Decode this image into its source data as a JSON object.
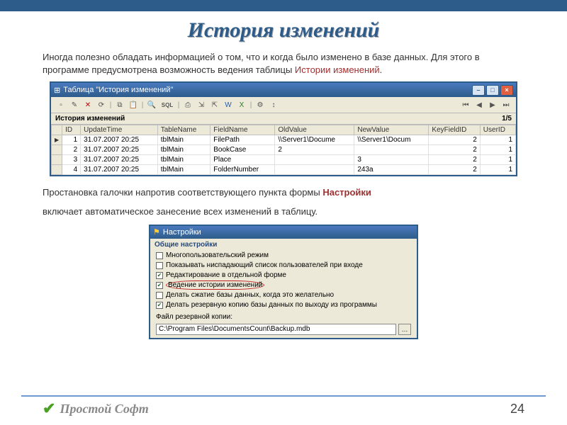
{
  "slide": {
    "title": "История изменений",
    "intro_plain": "Иногда полезно обладать информацией о том, что и когда было изменено в базе данных. Для этого в программе предусмотрена возможность ведения таблицы ",
    "intro_hl": "Истории изменений",
    "para2_a": "Простановка галочки напротив соответствующего пункта формы ",
    "para2_hl": "Настройки",
    "para2_b": "включает автоматическое занесение всех изменений в таблицу."
  },
  "history_window": {
    "title": "Таблица \"История изменений\"",
    "subheader": "История изменений",
    "counter": "1/5",
    "columns": [
      "ID",
      "UpdateTime",
      "TableName",
      "FieldName",
      "OldValue",
      "NewValue",
      "KeyFieldID",
      "UserID"
    ],
    "rows": [
      {
        "id": "1",
        "ut": "31.07.2007 20:25",
        "tn": "tblMain",
        "fn": "FilePath",
        "ov": "\\\\Server1\\Docume",
        "nv": "\\\\Server1\\Docum",
        "kf": "2",
        "uid": "1"
      },
      {
        "id": "2",
        "ut": "31.07.2007 20:25",
        "tn": "tblMain",
        "fn": "BookCase",
        "ov": "2",
        "nv": "",
        "kf": "2",
        "uid": "1"
      },
      {
        "id": "3",
        "ut": "31.07.2007 20:25",
        "tn": "tblMain",
        "fn": "Place",
        "ov": "",
        "nv": "3",
        "kf": "2",
        "uid": "1"
      },
      {
        "id": "4",
        "ut": "31.07.2007 20:25",
        "tn": "tblMain",
        "fn": "FolderNumber",
        "ov": "",
        "nv": "243a",
        "kf": "2",
        "uid": "1"
      }
    ]
  },
  "settings_window": {
    "title": "Настройки",
    "section": "Общие настройки",
    "options": [
      {
        "label": "Многопользовательский режим",
        "checked": false
      },
      {
        "label": "Показывать ниспадающий список пользователей при входе",
        "checked": false
      },
      {
        "label": "Редактирование в отдельной форме",
        "checked": true
      },
      {
        "label": "Ведение истории изменений",
        "checked": true,
        "circled": true
      },
      {
        "label": "Делать сжатие базы данных, когда это желательно",
        "checked": false
      },
      {
        "label": "Делать резервную копию базы данных по выходу из программы",
        "checked": true
      }
    ],
    "path_label": "Файл резервной копии:",
    "path_value": "C:\\Program Files\\DocumentsCount\\Backup.mdb"
  },
  "footer": {
    "brand": "Простой Софт",
    "page": "24"
  }
}
